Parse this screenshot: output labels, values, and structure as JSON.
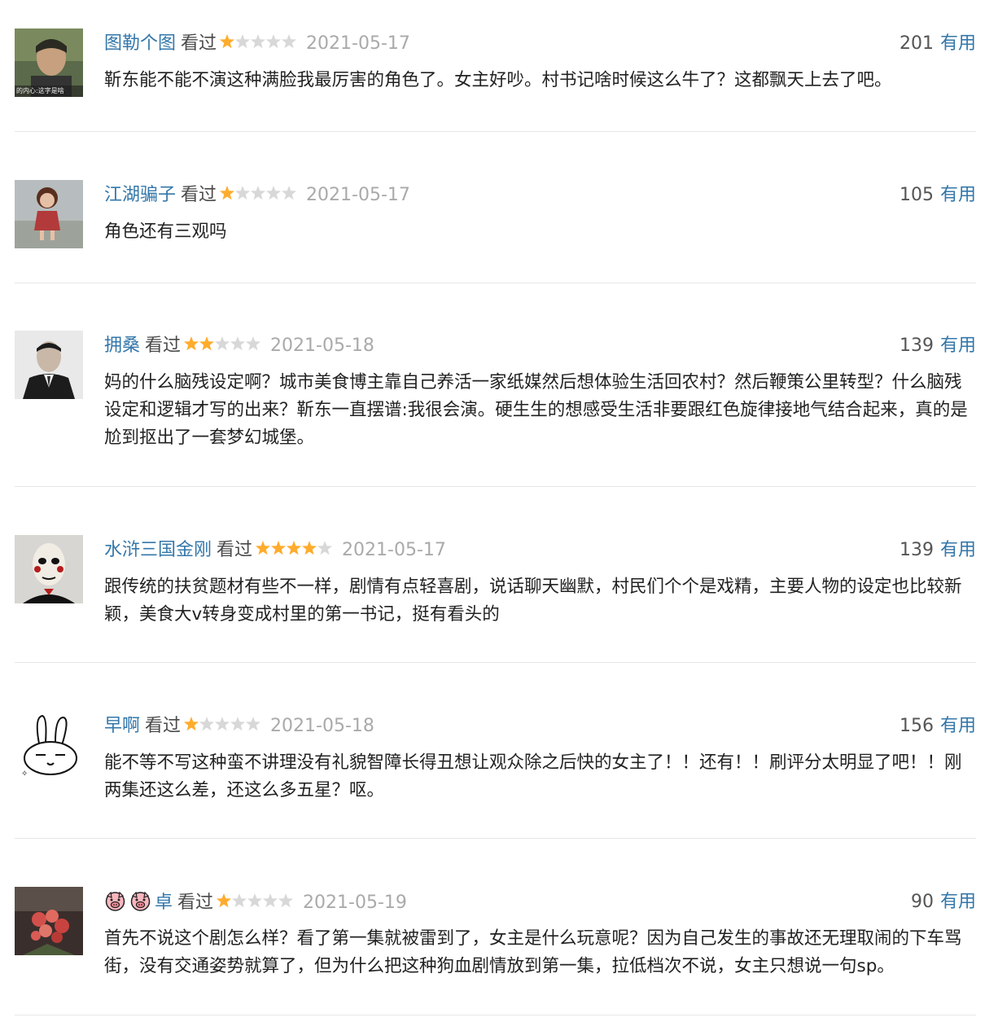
{
  "comments": [
    {
      "user": "图勒个图",
      "status": "看过",
      "stars": 1,
      "date": "2021-05-17",
      "votes": "201",
      "useful_label": "有用",
      "content": "靳东能不能不演这种满脸我最厉害的角色了。女主好吵。村书记啥时候这么牛了？这都飘天上去了吧。",
      "avatar": "man-portrait-avatar"
    },
    {
      "user": "江湖骗子",
      "status": "看过",
      "stars": 1,
      "date": "2021-05-17",
      "votes": "105",
      "useful_label": "有用",
      "content": "角色还有三观吗",
      "avatar": "doll-avatar"
    },
    {
      "user": "拥桑",
      "status": "看过",
      "stars": 2,
      "date": "2021-05-18",
      "votes": "139",
      "useful_label": "有用",
      "content": "妈的什么脑残设定啊？城市美食博主靠自己养活一家纸媒然后想体验生活回农村？然后鞭策公里转型？什么脑残设定和逻辑才写的出来？靳东一直摆谱:我很会演。硬生生的想感受生活非要跟红色旋律接地气结合起来，真的是尬到抠出了一套梦幻城堡。",
      "avatar": "man-suit-avatar"
    },
    {
      "user": "水浒三国金刚",
      "status": "看过",
      "stars": 4,
      "date": "2021-05-17",
      "votes": "139",
      "useful_label": "有用",
      "content": "跟传统的扶贫题材有些不一样，剧情有点轻喜剧，说话聊天幽默，村民们个个是戏精，主要人物的设定也比较新颖，美食大v转身变成村里的第一书记，挺有看头的",
      "avatar": "mask-avatar"
    },
    {
      "user": "早啊",
      "status": "看过",
      "stars": 1,
      "date": "2021-05-18",
      "votes": "156",
      "useful_label": "有用",
      "content": "能不等不写这种蛮不讲理没有礼貌智障长得丑想让观众除之后快的女主了！！还有！！刷评分太明显了吧！！刚两集还这么差，还这么多五星？呕。",
      "avatar": "rabbit-avatar"
    },
    {
      "user": "卓",
      "user_prefix_icons": [
        "pig-emoji-icon",
        "pig-emoji-icon"
      ],
      "status": "看过",
      "stars": 1,
      "date": "2021-05-19",
      "votes": "90",
      "useful_label": "有用",
      "content": "首先不说这个剧怎么样？看了第一集就被雷到了，女主是什么玩意呢？因为自己发生的事故还无理取闹的下车骂街，没有交通姿势就算了，但为什么把这种狗血剧情放到第一集，拉低档次不说，女主只想说一句sp。",
      "avatar": "roses-avatar"
    }
  ],
  "colors": {
    "link": "#3377aa",
    "star_filled": "#ffac2d",
    "star_empty": "#d8d8d8",
    "date": "#aaaaaa"
  }
}
